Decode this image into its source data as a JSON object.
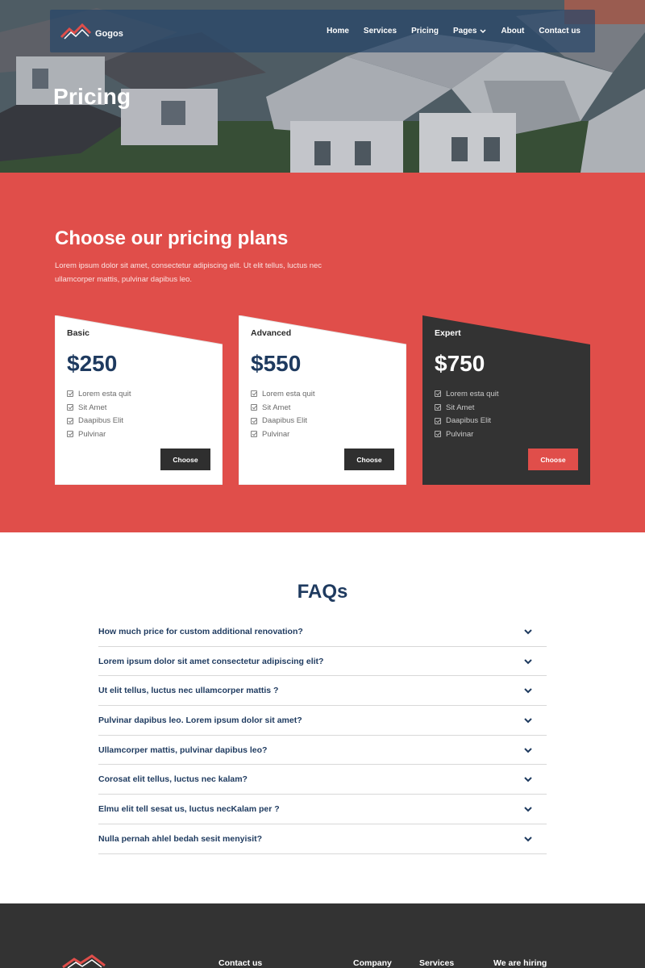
{
  "brand": {
    "name": "Gogos"
  },
  "nav": {
    "items": [
      "Home",
      "Services",
      "Pricing",
      "Pages",
      "About",
      "Contact us"
    ]
  },
  "hero": {
    "title": "Pricing"
  },
  "pricing": {
    "title": "Choose our pricing plans",
    "description": "Lorem ipsum dolor sit amet, consectetur adipiscing elit. Ut elit tellus, luctus nec ullamcorper mattis, pulvinar dapibus leo.",
    "plans": [
      {
        "name": "Basic",
        "price": "$250",
        "features": [
          "Lorem esta quit",
          "Sit Amet",
          "Daapibus Elit",
          "Pulvinar"
        ],
        "button": "Choose"
      },
      {
        "name": "Advanced",
        "price": "$550",
        "features": [
          "Lorem esta quit",
          "Sit Amet",
          "Daapibus Elit",
          "Pulvinar"
        ],
        "button": "Choose"
      },
      {
        "name": "Expert",
        "price": "$750",
        "features": [
          "Lorem esta quit",
          "Sit Amet",
          "Daapibus Elit",
          "Pulvinar"
        ],
        "button": "Choose"
      }
    ]
  },
  "faq": {
    "title": "FAQs",
    "questions": [
      "How much price for custom additional renovation?",
      "Lorem ipsum dolor sit amet consectetur adipiscing elit?",
      "Ut elit tellus, luctus nec ullamcorper mattis ?",
      "Pulvinar dapibus leo. Lorem ipsum dolor sit amet?",
      "Ullamcorper mattis, pulvinar dapibus leo?",
      "Corosat elit tellus, luctus nec kalam?",
      "Elmu elit tell sesat us, luctus necKalam per ?",
      "Nulla pernah ahlel bedah sesit menyisit?"
    ]
  },
  "footer": {
    "headings": [
      "Contact us",
      "Company",
      "Services",
      "We are hiring"
    ]
  },
  "colors": {
    "accent": "#e04e4a",
    "navy": "#1e3a5f",
    "dark": "#333333"
  }
}
